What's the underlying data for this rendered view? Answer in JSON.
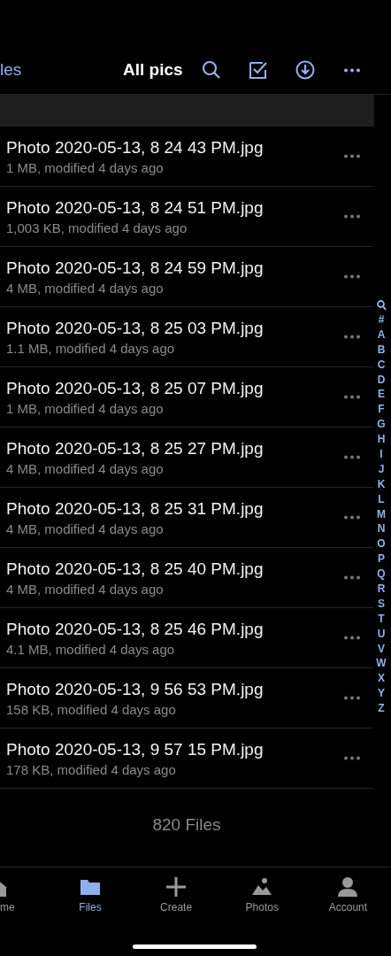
{
  "nav": {
    "back_label": "les",
    "title": "All pics"
  },
  "files": [
    {
      "name": "Photo 2020-05-13, 8 24 43 PM.jpg",
      "meta": "1 MB, modified 4 days ago"
    },
    {
      "name": "Photo 2020-05-13, 8 24 51 PM.jpg",
      "meta": "1,003 KB, modified 4 days ago"
    },
    {
      "name": "Photo 2020-05-13, 8 24 59 PM.jpg",
      "meta": "4 MB, modified 4 days ago"
    },
    {
      "name": "Photo 2020-05-13, 8 25 03 PM.jpg",
      "meta": "1.1 MB, modified 4 days ago"
    },
    {
      "name": "Photo 2020-05-13, 8 25 07 PM.jpg",
      "meta": "1 MB, modified 4 days ago"
    },
    {
      "name": "Photo 2020-05-13, 8 25 27 PM.jpg",
      "meta": "4 MB, modified 4 days ago"
    },
    {
      "name": "Photo 2020-05-13, 8 25 31 PM.jpg",
      "meta": "4 MB, modified 4 days ago"
    },
    {
      "name": "Photo 2020-05-13, 8 25 40 PM.jpg",
      "meta": "4 MB, modified 4 days ago"
    },
    {
      "name": "Photo 2020-05-13, 8 25 46 PM.jpg",
      "meta": "4.1 MB, modified 4 days ago"
    },
    {
      "name": "Photo 2020-05-13, 9 56 53 PM.jpg",
      "meta": "158 KB, modified 4 days ago"
    },
    {
      "name": "Photo 2020-05-13, 9 57 15 PM.jpg",
      "meta": "178 KB, modified 4 days ago"
    }
  ],
  "index_letters": [
    "#",
    "A",
    "B",
    "C",
    "D",
    "E",
    "F",
    "G",
    "H",
    "I",
    "J",
    "K",
    "L",
    "M",
    "N",
    "O",
    "P",
    "Q",
    "R",
    "S",
    "T",
    "U",
    "V",
    "W",
    "X",
    "Y",
    "Z"
  ],
  "file_count": "820 Files",
  "tabs": [
    {
      "kind": "home",
      "label": "me",
      "selected": false
    },
    {
      "kind": "files",
      "label": "Files",
      "selected": true
    },
    {
      "kind": "create",
      "label": "Create",
      "selected": false
    },
    {
      "kind": "photos",
      "label": "Photos",
      "selected": false
    },
    {
      "kind": "account",
      "label": "Account",
      "selected": false
    }
  ]
}
